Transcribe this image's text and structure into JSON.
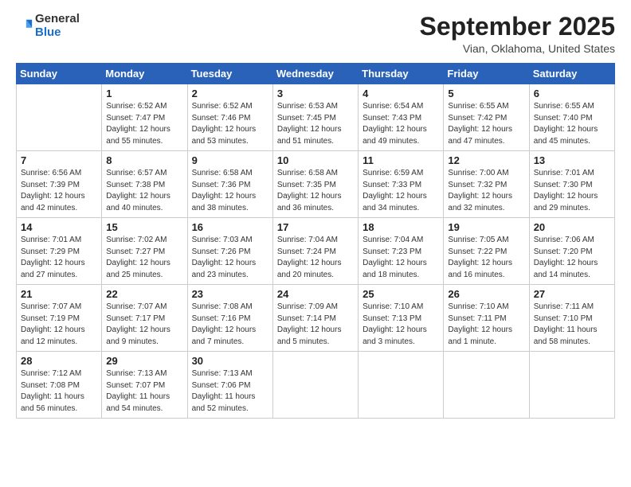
{
  "header": {
    "logo_general": "General",
    "logo_blue": "Blue",
    "month_title": "September 2025",
    "location": "Vian, Oklahoma, United States"
  },
  "days_of_week": [
    "Sunday",
    "Monday",
    "Tuesday",
    "Wednesday",
    "Thursday",
    "Friday",
    "Saturday"
  ],
  "weeks": [
    [
      {
        "day": "",
        "info": ""
      },
      {
        "day": "1",
        "info": "Sunrise: 6:52 AM\nSunset: 7:47 PM\nDaylight: 12 hours\nand 55 minutes."
      },
      {
        "day": "2",
        "info": "Sunrise: 6:52 AM\nSunset: 7:46 PM\nDaylight: 12 hours\nand 53 minutes."
      },
      {
        "day": "3",
        "info": "Sunrise: 6:53 AM\nSunset: 7:45 PM\nDaylight: 12 hours\nand 51 minutes."
      },
      {
        "day": "4",
        "info": "Sunrise: 6:54 AM\nSunset: 7:43 PM\nDaylight: 12 hours\nand 49 minutes."
      },
      {
        "day": "5",
        "info": "Sunrise: 6:55 AM\nSunset: 7:42 PM\nDaylight: 12 hours\nand 47 minutes."
      },
      {
        "day": "6",
        "info": "Sunrise: 6:55 AM\nSunset: 7:40 PM\nDaylight: 12 hours\nand 45 minutes."
      }
    ],
    [
      {
        "day": "7",
        "info": "Sunrise: 6:56 AM\nSunset: 7:39 PM\nDaylight: 12 hours\nand 42 minutes."
      },
      {
        "day": "8",
        "info": "Sunrise: 6:57 AM\nSunset: 7:38 PM\nDaylight: 12 hours\nand 40 minutes."
      },
      {
        "day": "9",
        "info": "Sunrise: 6:58 AM\nSunset: 7:36 PM\nDaylight: 12 hours\nand 38 minutes."
      },
      {
        "day": "10",
        "info": "Sunrise: 6:58 AM\nSunset: 7:35 PM\nDaylight: 12 hours\nand 36 minutes."
      },
      {
        "day": "11",
        "info": "Sunrise: 6:59 AM\nSunset: 7:33 PM\nDaylight: 12 hours\nand 34 minutes."
      },
      {
        "day": "12",
        "info": "Sunrise: 7:00 AM\nSunset: 7:32 PM\nDaylight: 12 hours\nand 32 minutes."
      },
      {
        "day": "13",
        "info": "Sunrise: 7:01 AM\nSunset: 7:30 PM\nDaylight: 12 hours\nand 29 minutes."
      }
    ],
    [
      {
        "day": "14",
        "info": "Sunrise: 7:01 AM\nSunset: 7:29 PM\nDaylight: 12 hours\nand 27 minutes."
      },
      {
        "day": "15",
        "info": "Sunrise: 7:02 AM\nSunset: 7:27 PM\nDaylight: 12 hours\nand 25 minutes."
      },
      {
        "day": "16",
        "info": "Sunrise: 7:03 AM\nSunset: 7:26 PM\nDaylight: 12 hours\nand 23 minutes."
      },
      {
        "day": "17",
        "info": "Sunrise: 7:04 AM\nSunset: 7:24 PM\nDaylight: 12 hours\nand 20 minutes."
      },
      {
        "day": "18",
        "info": "Sunrise: 7:04 AM\nSunset: 7:23 PM\nDaylight: 12 hours\nand 18 minutes."
      },
      {
        "day": "19",
        "info": "Sunrise: 7:05 AM\nSunset: 7:22 PM\nDaylight: 12 hours\nand 16 minutes."
      },
      {
        "day": "20",
        "info": "Sunrise: 7:06 AM\nSunset: 7:20 PM\nDaylight: 12 hours\nand 14 minutes."
      }
    ],
    [
      {
        "day": "21",
        "info": "Sunrise: 7:07 AM\nSunset: 7:19 PM\nDaylight: 12 hours\nand 12 minutes."
      },
      {
        "day": "22",
        "info": "Sunrise: 7:07 AM\nSunset: 7:17 PM\nDaylight: 12 hours\nand 9 minutes."
      },
      {
        "day": "23",
        "info": "Sunrise: 7:08 AM\nSunset: 7:16 PM\nDaylight: 12 hours\nand 7 minutes."
      },
      {
        "day": "24",
        "info": "Sunrise: 7:09 AM\nSunset: 7:14 PM\nDaylight: 12 hours\nand 5 minutes."
      },
      {
        "day": "25",
        "info": "Sunrise: 7:10 AM\nSunset: 7:13 PM\nDaylight: 12 hours\nand 3 minutes."
      },
      {
        "day": "26",
        "info": "Sunrise: 7:10 AM\nSunset: 7:11 PM\nDaylight: 12 hours\nand 1 minute."
      },
      {
        "day": "27",
        "info": "Sunrise: 7:11 AM\nSunset: 7:10 PM\nDaylight: 11 hours\nand 58 minutes."
      }
    ],
    [
      {
        "day": "28",
        "info": "Sunrise: 7:12 AM\nSunset: 7:08 PM\nDaylight: 11 hours\nand 56 minutes."
      },
      {
        "day": "29",
        "info": "Sunrise: 7:13 AM\nSunset: 7:07 PM\nDaylight: 11 hours\nand 54 minutes."
      },
      {
        "day": "30",
        "info": "Sunrise: 7:13 AM\nSunset: 7:06 PM\nDaylight: 11 hours\nand 52 minutes."
      },
      {
        "day": "",
        "info": ""
      },
      {
        "day": "",
        "info": ""
      },
      {
        "day": "",
        "info": ""
      },
      {
        "day": "",
        "info": ""
      }
    ]
  ]
}
